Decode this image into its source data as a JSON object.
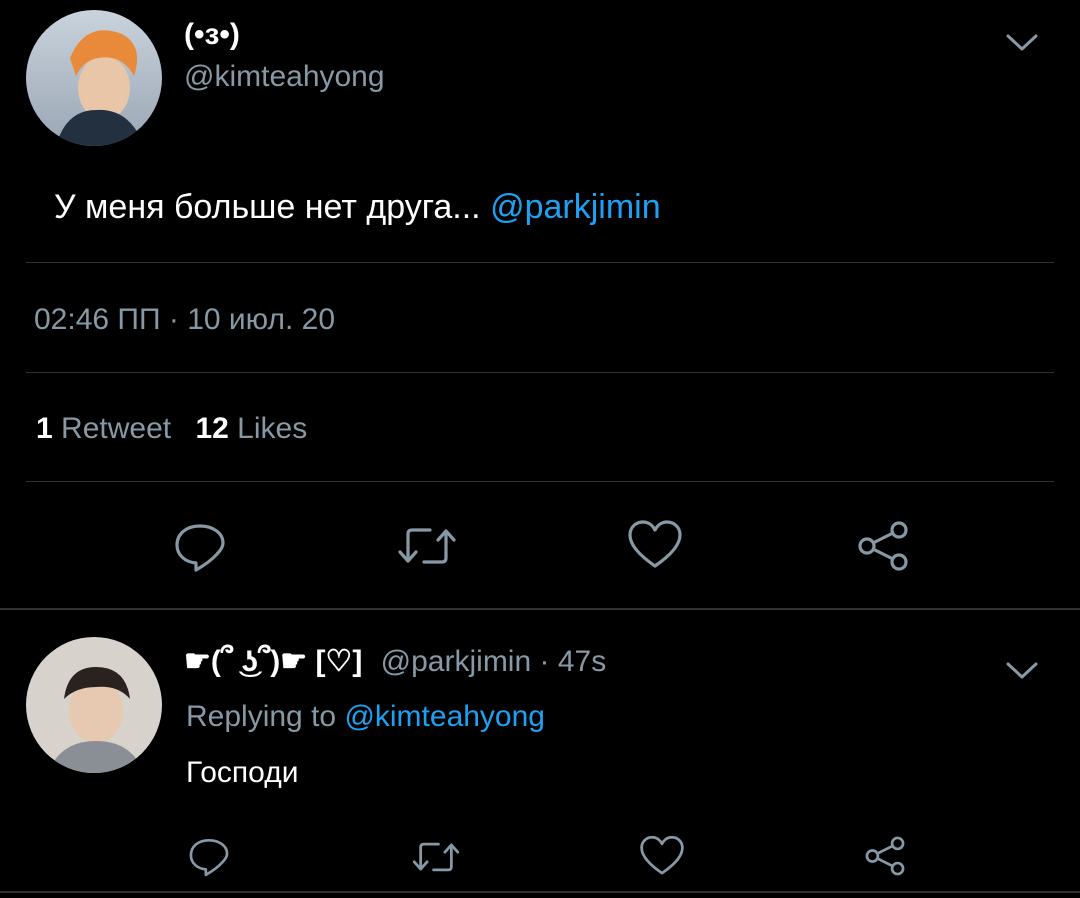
{
  "main_tweet": {
    "display_name": "(•з•)",
    "handle": "@kimteahyong",
    "text": "У меня больше нет друга...",
    "mention": "@parkjimin",
    "time": "02:46 ПП · 10 июл. 20",
    "retweet_count": "1",
    "retweet_label": "Retweet",
    "like_count": "12",
    "like_label": "Likes"
  },
  "reply_tweet": {
    "display_name": "☛(՞ ͜ʖ՞)☛ [♡]",
    "handle": "@parkjimin",
    "time_sep": "·",
    "age": "47s",
    "replying_label": "Replying to",
    "replying_handle": "@kimteahyong",
    "text": "Господи"
  },
  "colors": {
    "background": "#000000",
    "muted": "#8899a6",
    "link": "#1da1f2",
    "divider": "#2f3336"
  },
  "icons": [
    "chevron-down-icon",
    "reply-icon",
    "retweet-icon",
    "like-icon",
    "share-icon"
  ]
}
